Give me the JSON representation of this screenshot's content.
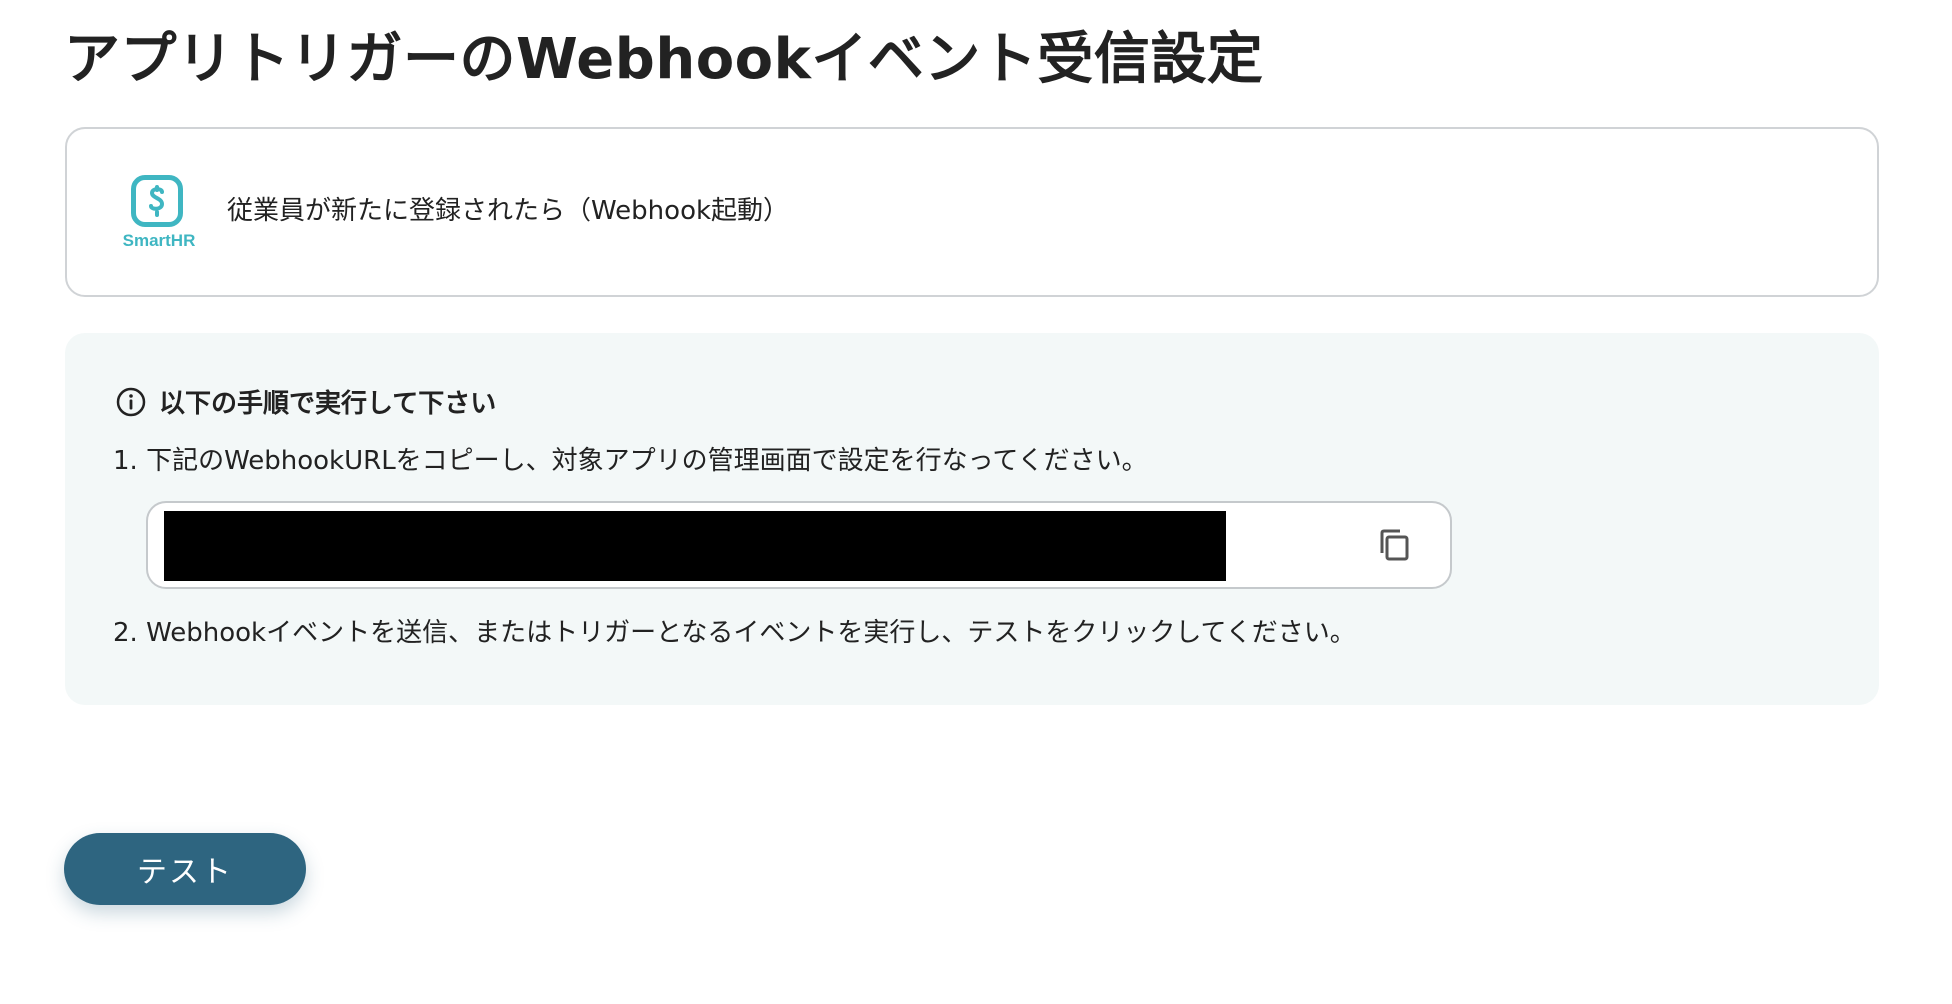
{
  "page": {
    "title": "アプリトリガーのWebhookイベント受信設定"
  },
  "trigger": {
    "app_name": "SmartHR",
    "label": "従業員が新たに登録されたら（Webhook起動）",
    "logo_icon": "smarthr-logo-icon",
    "brand_color": "#3fb6c2"
  },
  "instructions": {
    "heading": "以下の手順で実行して下さい",
    "heading_icon": "info-icon",
    "step1": "1. 下記のWebhookURLをコピーし、対象アプリの管理画面で設定を行なってください。",
    "copy_icon": "copy-icon",
    "step2": "2. Webhookイベントを送信、またはトリガーとなるイベントを実行し、テストをクリックしてください。"
  },
  "actions": {
    "test_label": "テスト",
    "accent_color": "#2e6580"
  }
}
